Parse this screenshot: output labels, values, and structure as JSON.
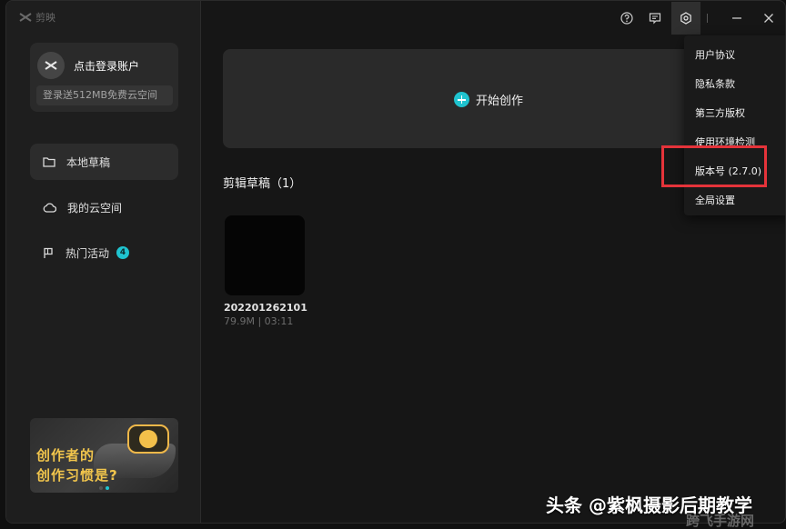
{
  "app": {
    "name": "剪映"
  },
  "account": {
    "login_label": "点击登录账户",
    "storage_label": "登录送512MB免费云空间"
  },
  "sidebar": {
    "items": [
      {
        "label": "本地草稿",
        "icon": "folder-icon",
        "active": true
      },
      {
        "label": "我的云空间",
        "icon": "cloud-icon",
        "active": false
      },
      {
        "label": "热门活动",
        "icon": "flag-icon",
        "active": false,
        "badge": "4"
      }
    ]
  },
  "promo": {
    "line1": "创作者的",
    "line2": "创作习惯是?"
  },
  "main": {
    "create_label": "开始创作",
    "drafts_title": "剪辑草稿（1）",
    "drafts": [
      {
        "name": "202201262101",
        "meta": "79.9M | 03:11"
      }
    ]
  },
  "settings_menu": {
    "items": [
      "用户协议",
      "隐私条款",
      "第三方版权",
      "使用环境检测",
      "版本号 (2.7.0)",
      "全局设置"
    ]
  },
  "watermark": {
    "text": "头条 @紫枫摄影后期教学",
    "corner": "跨飞手游网"
  },
  "colors": {
    "accent": "#1fc3cf",
    "highlight": "#e5333a"
  }
}
